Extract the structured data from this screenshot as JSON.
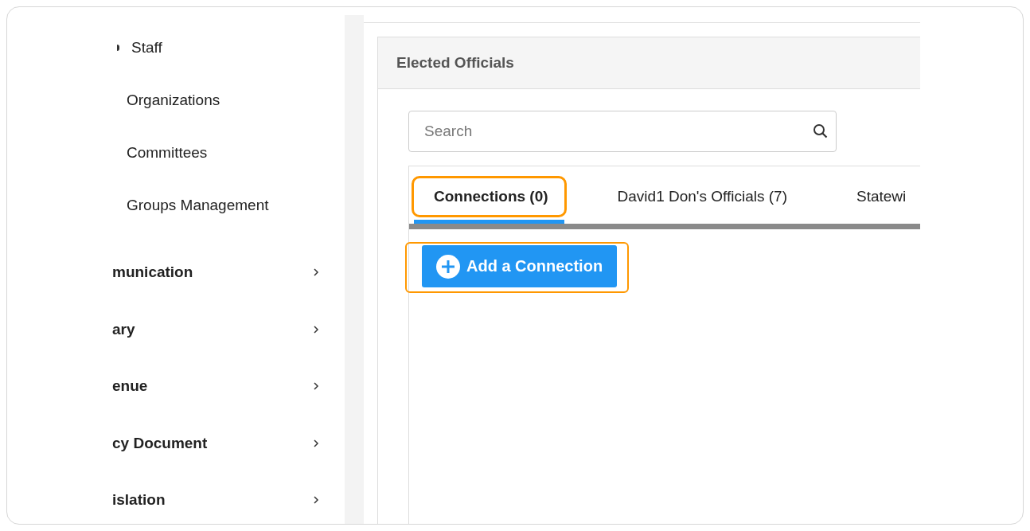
{
  "sidebar": {
    "items": [
      {
        "label": "Staff",
        "kind": "top",
        "has_chevron": false
      },
      {
        "label": "Organizations",
        "kind": "sub",
        "has_chevron": false
      },
      {
        "label": "Committees",
        "kind": "sub",
        "has_chevron": false
      },
      {
        "label": "Groups Management",
        "kind": "sub",
        "has_chevron": false
      },
      {
        "label": "munication",
        "kind": "section",
        "has_chevron": true
      },
      {
        "label": "ary",
        "kind": "section",
        "has_chevron": true
      },
      {
        "label": "enue",
        "kind": "section",
        "has_chevron": true
      },
      {
        "label": "cy Document",
        "kind": "section",
        "has_chevron": true
      },
      {
        "label": "islation",
        "kind": "section",
        "has_chevron": true
      }
    ]
  },
  "panel": {
    "title": "Elected Officials",
    "search": {
      "placeholder": "Search"
    },
    "tabs": [
      {
        "label": "Connections (0)",
        "selected": true,
        "highlighted": true
      },
      {
        "label": "David1 Don's Officials (7)",
        "selected": false,
        "highlighted": false
      },
      {
        "label": "Statewi",
        "selected": false,
        "highlighted": false
      }
    ],
    "add_button": {
      "label": "Add a Connection",
      "highlighted": true
    }
  }
}
